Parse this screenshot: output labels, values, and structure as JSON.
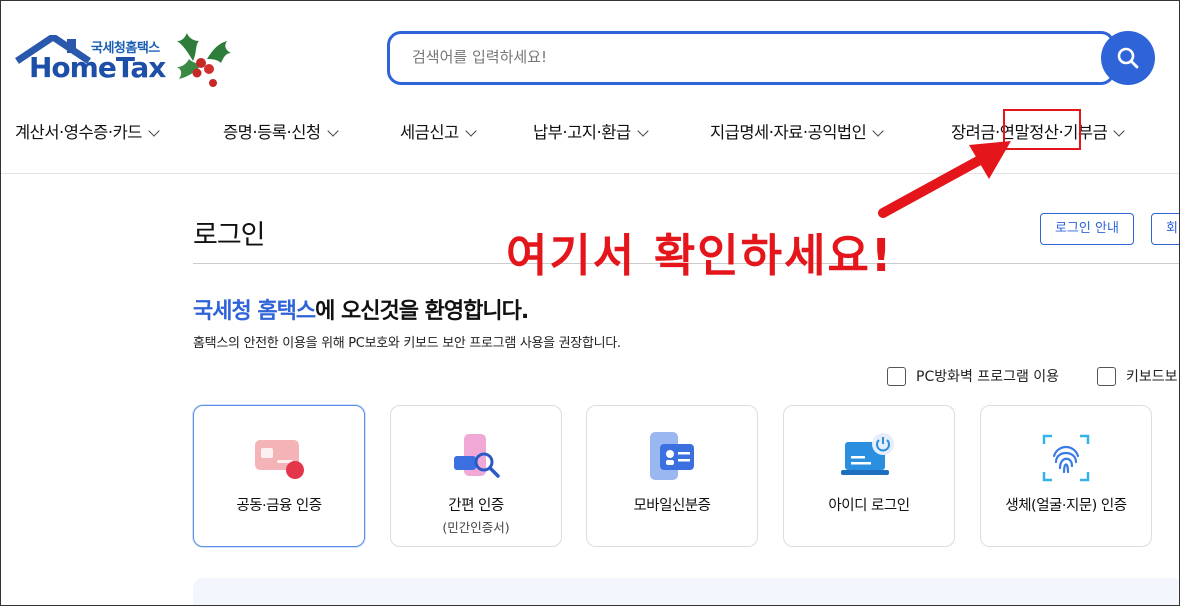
{
  "header": {
    "logo_sub": "국세청홈택스",
    "logo_main": "HomeTax",
    "search_placeholder": "검색어를 입력하세요!",
    "search_icon": "search-icon"
  },
  "nav": {
    "items": [
      {
        "label": "계산서·영수증·카드"
      },
      {
        "label": "증명·등록·신청"
      },
      {
        "label": "세금신고"
      },
      {
        "label": "납부·고지·환급"
      },
      {
        "label": "지급명세·자료·공익법인"
      },
      {
        "label": "장려금·연말정산·기부금"
      }
    ]
  },
  "main": {
    "title": "로그인",
    "login_guide_button": "로그인 안내",
    "second_button_partial": "회",
    "welcome_brand": "국세청 홈택스",
    "welcome_rest": "에 오신것을 환영합니다.",
    "notice": "홈택스의 안전한 이용을 위해 PC보호와 키보드 보안 프로그램 사용을 권장합니다.",
    "checks": [
      {
        "label": "PC방화벽 프로그램 이용",
        "checked": false
      },
      {
        "label": "키보드보",
        "checked": false
      }
    ],
    "login_methods": [
      {
        "label": "공동·금융 인증",
        "sub": "",
        "icon": "certificate-card-icon",
        "active": true
      },
      {
        "label": "간편 인증",
        "sub": "(민간인증서)",
        "icon": "simple-auth-icon",
        "active": false
      },
      {
        "label": "모바일신분증",
        "sub": "",
        "icon": "mobile-id-icon",
        "active": false
      },
      {
        "label": "아이디 로그인",
        "sub": "",
        "icon": "id-login-icon",
        "active": false
      },
      {
        "label": "생체(얼굴·지문) 인증",
        "sub": "",
        "icon": "fingerprint-icon",
        "active": false
      }
    ]
  },
  "annotation": {
    "text": "여기서 확인하세요!",
    "color": "#e4161b"
  },
  "colors": {
    "brand_blue": "#2f63d8",
    "annotation_red": "#e4161b"
  }
}
